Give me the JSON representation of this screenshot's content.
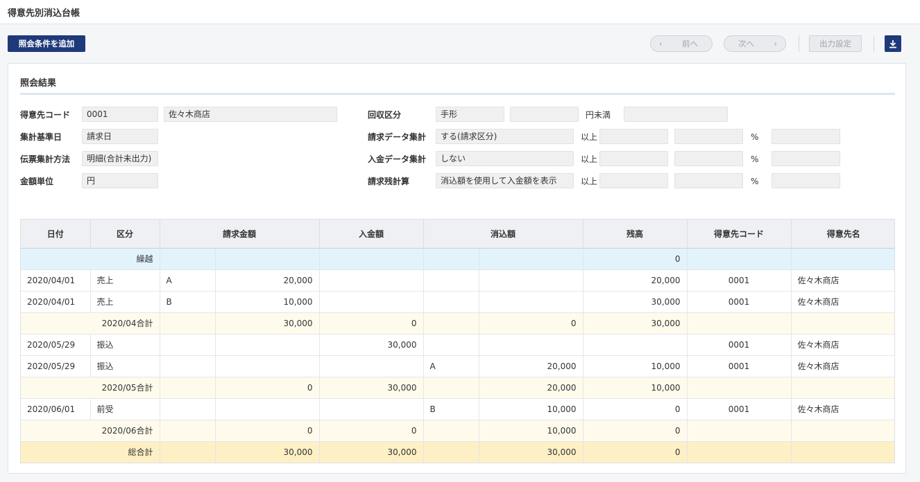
{
  "page": {
    "title": "得意先別消込台帳"
  },
  "toolbar": {
    "add_condition": "照会条件を追加",
    "prev": "前へ",
    "next": "次へ",
    "output_settings": "出力設定",
    "prev_arrow": "‹",
    "next_arrow": "›"
  },
  "result": {
    "title": "照会結果",
    "customer_code_label": "得意先コード",
    "customer_code": "0001",
    "customer_name": "佐々木商店",
    "base_date_label": "集計基準日",
    "base_date": "請求日",
    "slip_method_label": "伝票集計方法",
    "slip_method": "明細(合計未出力)",
    "amount_unit_label": "金額単位",
    "amount_unit": "円",
    "collection_label": "回収区分",
    "collection_value": "手形",
    "collection_value2": "",
    "yen_under": "円未満",
    "collection_value3": "",
    "billing_agg_label": "請求データ集計",
    "billing_agg": "する(請求区分)",
    "payment_agg_label": "入金データ集計",
    "payment_agg": "しない",
    "balance_calc_label": "請求残計算",
    "balance_calc": "消込額を使用して入金額を表示",
    "above": "以上",
    "percent": "%"
  },
  "table": {
    "headers": [
      "日付",
      "区分",
      "請求金額",
      "入金額",
      "消込額",
      "残高",
      "得意先コード",
      "得意先名"
    ],
    "rows": [
      {
        "type": "carry",
        "label": "繰越",
        "balance": "0"
      },
      {
        "type": "data",
        "date": "2020/04/01",
        "kubun": "売上",
        "bill_code": "A",
        "bill_amt": "20,000",
        "pay_amt": "",
        "clr_code": "",
        "clr_amt": "",
        "balance": "20,000",
        "cust_code": "0001",
        "cust_name": "佐々木商店"
      },
      {
        "type": "data",
        "date": "2020/04/01",
        "kubun": "売上",
        "bill_code": "B",
        "bill_amt": "10,000",
        "pay_amt": "",
        "clr_code": "",
        "clr_amt": "",
        "balance": "30,000",
        "cust_code": "0001",
        "cust_name": "佐々木商店"
      },
      {
        "type": "sub",
        "label": "2020/04合計",
        "bill_amt": "30,000",
        "pay_amt": "0",
        "clr_amt": "0",
        "balance": "30,000"
      },
      {
        "type": "data",
        "date": "2020/05/29",
        "kubun": "振込",
        "bill_code": "",
        "bill_amt": "",
        "pay_amt": "30,000",
        "clr_code": "",
        "clr_amt": "",
        "balance": "",
        "cust_code": "0001",
        "cust_name": "佐々木商店"
      },
      {
        "type": "data",
        "date": "2020/05/29",
        "kubun": "振込",
        "bill_code": "",
        "bill_amt": "",
        "pay_amt": "",
        "clr_code": "A",
        "clr_amt": "20,000",
        "balance": "10,000",
        "cust_code": "0001",
        "cust_name": "佐々木商店"
      },
      {
        "type": "sub",
        "label": "2020/05合計",
        "bill_amt": "0",
        "pay_amt": "30,000",
        "clr_amt": "20,000",
        "balance": "10,000"
      },
      {
        "type": "data",
        "date": "2020/06/01",
        "kubun": "前受",
        "bill_code": "",
        "bill_amt": "",
        "pay_amt": "",
        "clr_code": "B",
        "clr_amt": "10,000",
        "balance": "0",
        "cust_code": "0001",
        "cust_name": "佐々木商店"
      },
      {
        "type": "sub",
        "label": "2020/06合計",
        "bill_amt": "0",
        "pay_amt": "0",
        "clr_amt": "10,000",
        "balance": "0"
      },
      {
        "type": "total",
        "label": "総合計",
        "bill_amt": "30,000",
        "pay_amt": "30,000",
        "clr_amt": "30,000",
        "balance": "0"
      }
    ]
  },
  "colors": {
    "primary": "#1f3a7a",
    "carry_row": "#e2f3fb",
    "subtotal_row": "#fffbec",
    "total_row": "#fdf0c5"
  },
  "icons": {
    "download": "download-icon"
  }
}
